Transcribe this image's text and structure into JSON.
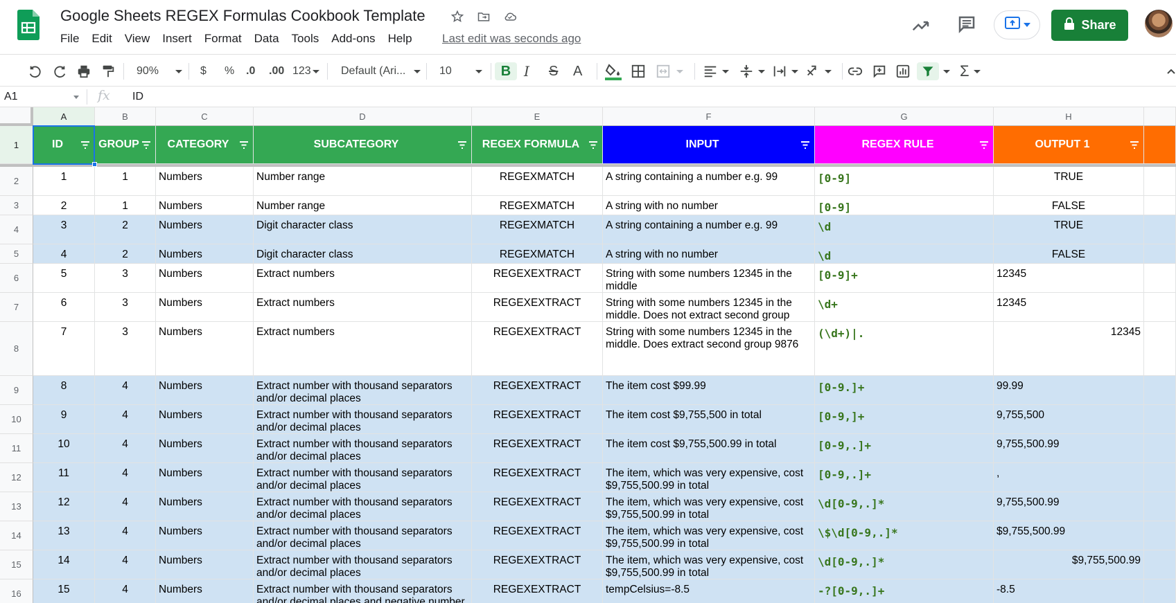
{
  "app": {
    "doc_title": "Google Sheets REGEX Formulas Cookbook Template",
    "last_edit": "Last edit was seconds ago",
    "share_label": "Share",
    "menu": [
      "File",
      "Edit",
      "View",
      "Insert",
      "Format",
      "Data",
      "Tools",
      "Add-ons",
      "Help"
    ],
    "icons": [
      "sheets-logo",
      "star-icon",
      "move-to-folder-icon",
      "cloud-status-icon",
      "trend-icon",
      "comment-icon",
      "present-icon",
      "lock-icon"
    ]
  },
  "toolbar": {
    "zoom": "90%",
    "currency": "$",
    "percent": "%",
    "dec_decrease": ".0",
    "dec_increase": ".00",
    "more_formats": "123",
    "font": "Default (Ari...",
    "font_size": "10",
    "bold": "B",
    "italic": "I",
    "strike": "S",
    "text_color": "A",
    "functions": "Σ"
  },
  "formula_bar": {
    "cell_ref": "A1",
    "fx": "fx",
    "content": "ID"
  },
  "grid": {
    "columns": [
      "A",
      "B",
      "C",
      "D",
      "E",
      "F",
      "G",
      "H"
    ],
    "header": {
      "id": "ID",
      "group": "GROUP",
      "category": "CATEGORY",
      "subcategory": "SUBCATEGORY",
      "formula": "REGEX FORMULA",
      "input": "INPUT",
      "rule": "REGEX RULE",
      "output": "OUTPUT 1"
    },
    "header_colors": {
      "green": "#34a853",
      "blue": "#0000ff",
      "magenta": "#ff00ff",
      "orange": "#ff6d01"
    },
    "rows": [
      {
        "n": "2",
        "id": "1",
        "group": "1",
        "category": "Numbers",
        "subcategory": "Number range",
        "formula": "REGEXMATCH",
        "input": "A string containing a number e.g. 99",
        "rule": "[0-9]",
        "output": "TRUE"
      },
      {
        "n": "3",
        "id": "2",
        "group": "1",
        "category": "Numbers",
        "subcategory": "Number range",
        "formula": "REGEXMATCH",
        "input": "A string with no number",
        "rule": "[0-9]",
        "output": "FALSE"
      },
      {
        "n": "4",
        "id": "3",
        "group": "2",
        "category": "Numbers",
        "subcategory": "Digit character class",
        "formula": "REGEXMATCH",
        "input": "A string containing a number e.g. 99",
        "rule": "\\d",
        "output": "TRUE"
      },
      {
        "n": "5",
        "id": "4",
        "group": "2",
        "category": "Numbers",
        "subcategory": "Digit character class",
        "formula": "REGEXMATCH",
        "input": "A string with no number",
        "rule": "\\d",
        "output": "FALSE"
      },
      {
        "n": "6",
        "id": "5",
        "group": "3",
        "category": "Numbers",
        "subcategory": "Extract numbers",
        "formula": "REGEXEXTRACT",
        "input": "String with some numbers 12345 in the middle",
        "rule": "[0-9]+",
        "output": "12345"
      },
      {
        "n": "7",
        "id": "6",
        "group": "3",
        "category": "Numbers",
        "subcategory": "Extract numbers",
        "formula": "REGEXEXTRACT",
        "input": "String with some numbers 12345 in the middle. Does not extract second group 9876",
        "rule": "\\d+",
        "output": "12345"
      },
      {
        "n": "8",
        "id": "7",
        "group": "3",
        "category": "Numbers",
        "subcategory": "Extract numbers",
        "formula": "REGEXEXTRACT",
        "input": "String with some numbers 12345 in the middle. Does extract second group 9876",
        "rule": "(\\d+)|.",
        "output": "12345"
      },
      {
        "n": "9",
        "id": "8",
        "group": "4",
        "category": "Numbers",
        "subcategory": "Extract number with thousand separators and/or decimal places",
        "formula": "REGEXEXTRACT",
        "input": "The item cost $99.99",
        "rule": "[0-9.]+",
        "output": "99.99"
      },
      {
        "n": "10",
        "id": "9",
        "group": "4",
        "category": "Numbers",
        "subcategory": "Extract number with thousand separators and/or decimal places",
        "formula": "REGEXEXTRACT",
        "input": "The item cost $9,755,500 in total",
        "rule": "[0-9,]+",
        "output": "9,755,500"
      },
      {
        "n": "11",
        "id": "10",
        "group": "4",
        "category": "Numbers",
        "subcategory": "Extract number with thousand separators and/or decimal places",
        "formula": "REGEXEXTRACT",
        "input": "The item cost $9,755,500.99 in total",
        "rule": "[0-9,.]+",
        "output": "9,755,500.99"
      },
      {
        "n": "12",
        "id": "11",
        "group": "4",
        "category": "Numbers",
        "subcategory": "Extract number with thousand separators and/or decimal places",
        "formula": "REGEXEXTRACT",
        "input": "The item, which was very expensive, cost $9,755,500.99 in total",
        "rule": "[0-9,.]+",
        "output": ","
      },
      {
        "n": "13",
        "id": "12",
        "group": "4",
        "category": "Numbers",
        "subcategory": "Extract number with thousand separators and/or decimal places",
        "formula": "REGEXEXTRACT",
        "input": "The item, which was very expensive, cost $9,755,500.99 in total",
        "rule": "\\d[0-9,.]*",
        "output": "9,755,500.99"
      },
      {
        "n": "14",
        "id": "13",
        "group": "4",
        "category": "Numbers",
        "subcategory": "Extract number with thousand separators and/or decimal places",
        "formula": "REGEXEXTRACT",
        "input": "The item, which was very expensive, cost $9,755,500.99 in total",
        "rule": "\\$\\d[0-9,.]*",
        "output": "$9,755,500.99"
      },
      {
        "n": "15",
        "id": "14",
        "group": "4",
        "category": "Numbers",
        "subcategory": "Extract number with thousand separators and/or decimal places",
        "formula": "REGEXEXTRACT",
        "input": "The item, which was very expensive, cost $9,755,500.99 in total",
        "rule": "\\d[0-9,.]*",
        "output": "$9,755,500.99"
      },
      {
        "n": "16",
        "id": "15",
        "group": "4",
        "category": "Numbers",
        "subcategory": "Extract number with thousand separators and/or decimal places and negative number in",
        "formula": "REGEXEXTRACT",
        "input": "tempCelsius=-8.5",
        "rule": "-?[0-9,.]+",
        "output": "-8.5"
      }
    ]
  }
}
